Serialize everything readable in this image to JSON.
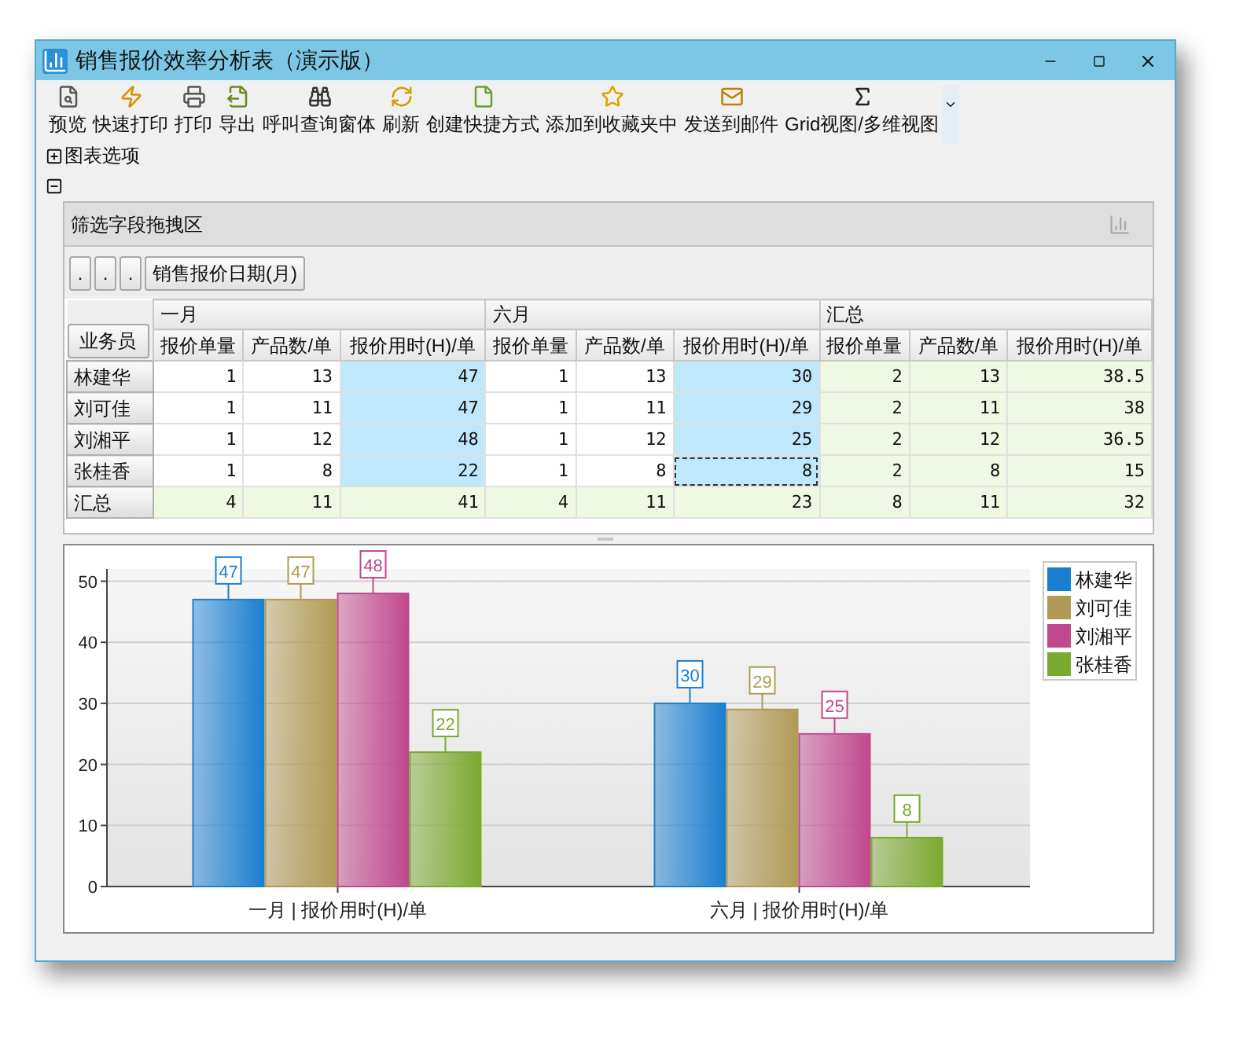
{
  "window": {
    "title": "销售报价效率分析表（演示版）"
  },
  "toolbar": [
    {
      "label": "预览"
    },
    {
      "label": "快速打印"
    },
    {
      "label": "打印"
    },
    {
      "label": "导出"
    },
    {
      "label": "呼叫查询窗体"
    },
    {
      "label": "刷新"
    },
    {
      "label": "创建快捷方式"
    },
    {
      "label": "添加到收藏夹中"
    },
    {
      "label": "发送到邮件"
    },
    {
      "label": "Grid视图/多维视图"
    }
  ],
  "chart_options": {
    "label": "图表选项",
    "expanded": false
  },
  "pivot_section": {
    "expanded": true
  },
  "pivot": {
    "filter_area": "筛选字段拖拽区",
    "field_buttons": [
      {
        "label": "."
      },
      {
        "label": "."
      },
      {
        "label": "."
      },
      {
        "label": "销售报价日期(月)"
      }
    ],
    "row_field": "业务员",
    "column_groups": [
      {
        "label": "一月",
        "kind": "month",
        "columns": [
          {
            "label": "报价单量",
            "highlighted": false
          },
          {
            "label": "产品数/单",
            "highlighted": false
          },
          {
            "label": "报价用时(H)/单",
            "highlighted": true
          }
        ]
      },
      {
        "label": "六月",
        "kind": "month",
        "columns": [
          {
            "label": "报价单量",
            "highlighted": false
          },
          {
            "label": "产品数/单",
            "highlighted": false
          },
          {
            "label": "报价用时(H)/单",
            "highlighted": true
          }
        ]
      },
      {
        "label": "汇总",
        "kind": "summary",
        "columns": [
          {
            "label": "报价单量",
            "highlighted": false
          },
          {
            "label": "产品数/单",
            "highlighted": false
          },
          {
            "label": "报价用时(H)/单",
            "highlighted": false
          }
        ]
      }
    ],
    "rows": [
      {
        "name": "林建华",
        "kind": "data",
        "cells": [
          {
            "text": "1",
            "focused": false
          },
          {
            "text": "13",
            "focused": false
          },
          {
            "text": "47",
            "focused": false
          },
          {
            "text": "1",
            "focused": false
          },
          {
            "text": "13",
            "focused": false
          },
          {
            "text": "30",
            "focused": false
          },
          {
            "text": "2",
            "focused": false
          },
          {
            "text": "13",
            "focused": false
          },
          {
            "text": "38.5",
            "focused": false
          }
        ]
      },
      {
        "name": "刘可佳",
        "kind": "data",
        "cells": [
          {
            "text": "1",
            "focused": false
          },
          {
            "text": "11",
            "focused": false
          },
          {
            "text": "47",
            "focused": false
          },
          {
            "text": "1",
            "focused": false
          },
          {
            "text": "11",
            "focused": false
          },
          {
            "text": "29",
            "focused": false
          },
          {
            "text": "2",
            "focused": false
          },
          {
            "text": "11",
            "focused": false
          },
          {
            "text": "38",
            "focused": false
          }
        ]
      },
      {
        "name": "刘湘平",
        "kind": "data",
        "cells": [
          {
            "text": "1",
            "focused": false
          },
          {
            "text": "12",
            "focused": false
          },
          {
            "text": "48",
            "focused": false
          },
          {
            "text": "1",
            "focused": false
          },
          {
            "text": "12",
            "focused": false
          },
          {
            "text": "25",
            "focused": false
          },
          {
            "text": "2",
            "focused": false
          },
          {
            "text": "12",
            "focused": false
          },
          {
            "text": "36.5",
            "focused": false
          }
        ]
      },
      {
        "name": "张桂香",
        "kind": "data",
        "cells": [
          {
            "text": "1",
            "focused": false
          },
          {
            "text": "8",
            "focused": false
          },
          {
            "text": "22",
            "focused": false
          },
          {
            "text": "1",
            "focused": false
          },
          {
            "text": "8",
            "focused": false
          },
          {
            "text": "8",
            "focused": true
          },
          {
            "text": "2",
            "focused": false
          },
          {
            "text": "8",
            "focused": false
          },
          {
            "text": "15",
            "focused": false
          }
        ]
      },
      {
        "name": "汇总",
        "kind": "total",
        "cells": [
          {
            "text": "4",
            "focused": false
          },
          {
            "text": "11",
            "focused": false
          },
          {
            "text": "41",
            "focused": false
          },
          {
            "text": "4",
            "focused": false
          },
          {
            "text": "11",
            "focused": false
          },
          {
            "text": "23",
            "focused": false
          },
          {
            "text": "8",
            "focused": false
          },
          {
            "text": "11",
            "focused": false
          },
          {
            "text": "32",
            "focused": false
          }
        ]
      }
    ]
  },
  "chart": {
    "chart_data": {
      "type": "bar",
      "categories": [
        "一月 | 报价用时(H)/单",
        "六月 | 报价用时(H)/单"
      ],
      "series": [
        {
          "name": "林建华",
          "color": "#1a7fd0",
          "values": [
            47,
            30
          ]
        },
        {
          "name": "刘可佳",
          "color": "#b09a55",
          "values": [
            47,
            29
          ]
        },
        {
          "name": "刘湘平",
          "color": "#c0488e",
          "values": [
            48,
            25
          ]
        },
        {
          "name": "张桂香",
          "color": "#7aaa30",
          "values": [
            22,
            8
          ]
        }
      ],
      "ylim": [
        0,
        52
      ],
      "yticks": [
        0,
        10,
        20,
        30,
        40,
        50
      ],
      "data_labels": true,
      "value_labels": [
        [
          "47",
          "30"
        ],
        [
          "47",
          "29"
        ],
        [
          "48",
          "25"
        ],
        [
          "22",
          "8"
        ]
      ],
      "grid": true,
      "legend": true
    }
  }
}
